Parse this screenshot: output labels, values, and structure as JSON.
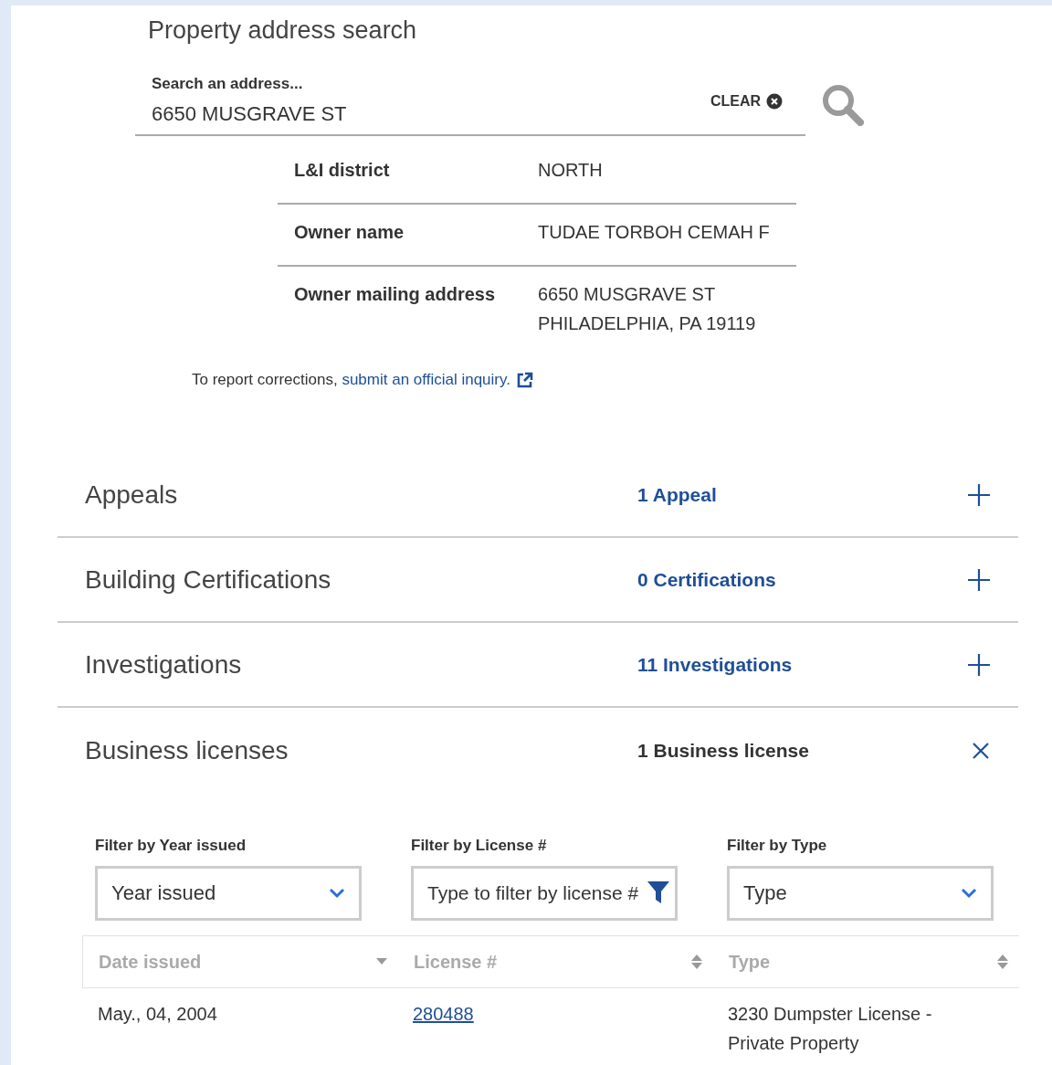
{
  "search": {
    "title": "Property address search",
    "label": "Search an address...",
    "value": "6650 MUSGRAVE ST",
    "clear": "CLEAR"
  },
  "details": [
    {
      "label": "L&I district",
      "lines": [
        "NORTH"
      ]
    },
    {
      "label": "Owner name",
      "lines": [
        "TUDAE TORBOH CEMAH F"
      ]
    },
    {
      "label": "Owner mailing address",
      "lines": [
        "6650 MUSGRAVE ST",
        "PHILADELPHIA, PA 19119"
      ]
    }
  ],
  "report": {
    "text": "To report corrections,",
    "link": "submit an official inquiry."
  },
  "sections": [
    {
      "title": "Appeals",
      "count": "1 Appeal",
      "expanded": false
    },
    {
      "title": "Building Certifications",
      "count": "0 Certifications",
      "expanded": false
    },
    {
      "title": "Investigations",
      "count": "11 Investigations",
      "expanded": false
    },
    {
      "title": "Business licenses",
      "count": "1 Business license",
      "expanded": true
    }
  ],
  "filters": [
    {
      "kind": "select",
      "label": "Filter by Year issued",
      "value": "Year issued"
    },
    {
      "kind": "text",
      "label": "Filter by License #",
      "placeholder": "Type to filter by license #"
    },
    {
      "kind": "select",
      "label": "Filter by Type",
      "value": "Type"
    }
  ],
  "table": {
    "columns": [
      {
        "label": "Date issued",
        "sorted": true
      },
      {
        "label": "License #",
        "sorted": false
      },
      {
        "label": "Type",
        "sorted": false
      }
    ],
    "rows": [
      {
        "date": "May., 04, 2004",
        "license": "280488",
        "type": "3230 Dumpster License - Private Property"
      }
    ]
  }
}
